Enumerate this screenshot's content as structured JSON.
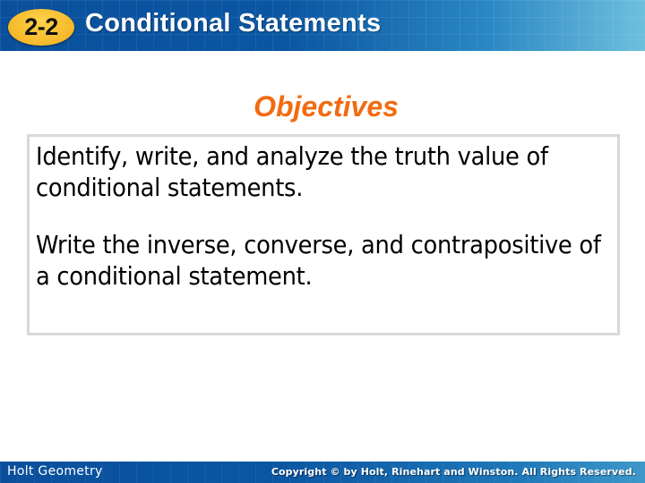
{
  "header": {
    "lesson_number": "2-2",
    "title": "Conditional Statements"
  },
  "section": {
    "heading": "Objectives"
  },
  "objectives": [
    {
      "text": "Identify, write, and analyze the truth value of conditional statements."
    },
    {
      "text": "Write the inverse, converse, and contrapositive of a conditional statement."
    }
  ],
  "footer": {
    "course": "Holt Geometry",
    "copyright": "Copyright © by Holt, Rinehart and Winston. All Rights Reserved."
  },
  "colors": {
    "header_blue": "#0b57a3",
    "badge_yellow": "#f5b82a",
    "heading_orange": "#f26b12",
    "box_border": "#d9d9d9"
  }
}
